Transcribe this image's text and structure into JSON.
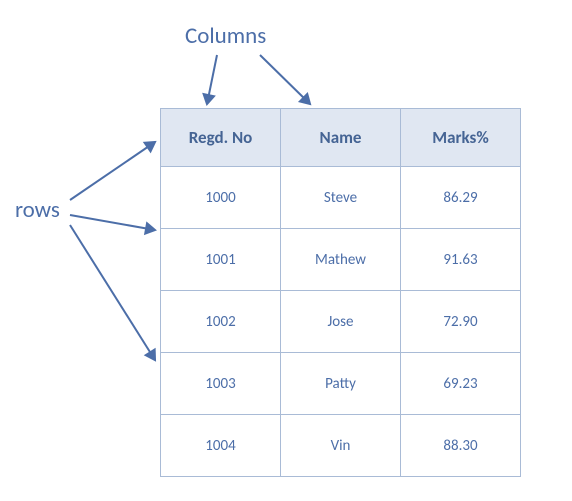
{
  "labels": {
    "columns": "Columns",
    "rows": "rows"
  },
  "table": {
    "headers": [
      "Regd. No",
      "Name",
      "Marks%"
    ],
    "rows": [
      {
        "regd_no": "1000",
        "name": "Steve",
        "marks": "86.29"
      },
      {
        "regd_no": "1001",
        "name": "Mathew",
        "marks": "91.63"
      },
      {
        "regd_no": "1002",
        "name": "Jose",
        "marks": "72.90"
      },
      {
        "regd_no": "1003",
        "name": "Patty",
        "marks": "69.23"
      },
      {
        "regd_no": "1004",
        "name": "Vin",
        "marks": "88.30"
      }
    ]
  }
}
